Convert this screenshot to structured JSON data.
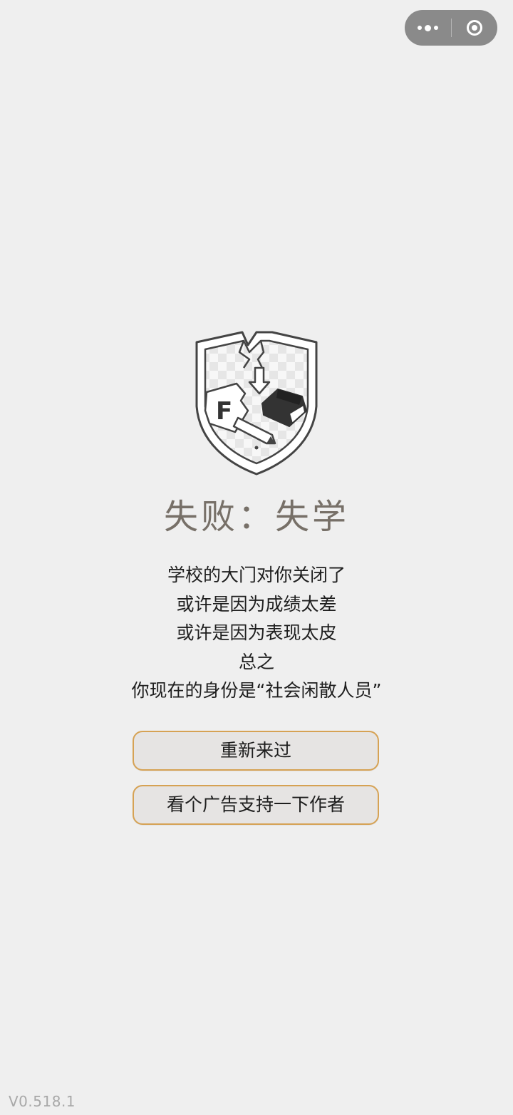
{
  "capsule": {
    "more_icon": "more-dots-icon",
    "close_icon": "target-close-icon"
  },
  "emblem": {
    "icon": "broken-school-shield-icon",
    "grade_letter": "F"
  },
  "result": {
    "title": "失败：失学",
    "lines": [
      "学校的大门对你关闭了",
      "或许是因为成绩太差",
      "或许是因为表现太皮",
      "总之",
      "你现在的身份是“社会闲散人员”"
    ]
  },
  "actions": {
    "restart_label": "重新来过",
    "ad_label": "看个广告支持一下作者"
  },
  "footer": {
    "version": "V0.518.1"
  },
  "colors": {
    "background": "#efefef",
    "button_border": "#d6a254",
    "button_fill": "#e6e4e3",
    "title": "#777068"
  }
}
